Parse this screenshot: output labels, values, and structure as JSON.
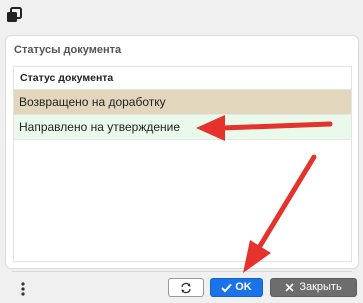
{
  "panel": {
    "title": "Статусы документа"
  },
  "table": {
    "column_header": "Статус документа",
    "rows": [
      {
        "label": "Возвращено на доработку",
        "highlight": "#e2d6bd"
      },
      {
        "label": "Направлено на утверждение",
        "highlight": "#eafaea"
      }
    ]
  },
  "buttons": {
    "refresh_icon": "refresh-icon",
    "ok_label": "OK",
    "close_label": "Закрыть"
  },
  "colors": {
    "ok": "#1a73e8",
    "close": "#6d6d6d",
    "annotation": "#e5322d"
  }
}
